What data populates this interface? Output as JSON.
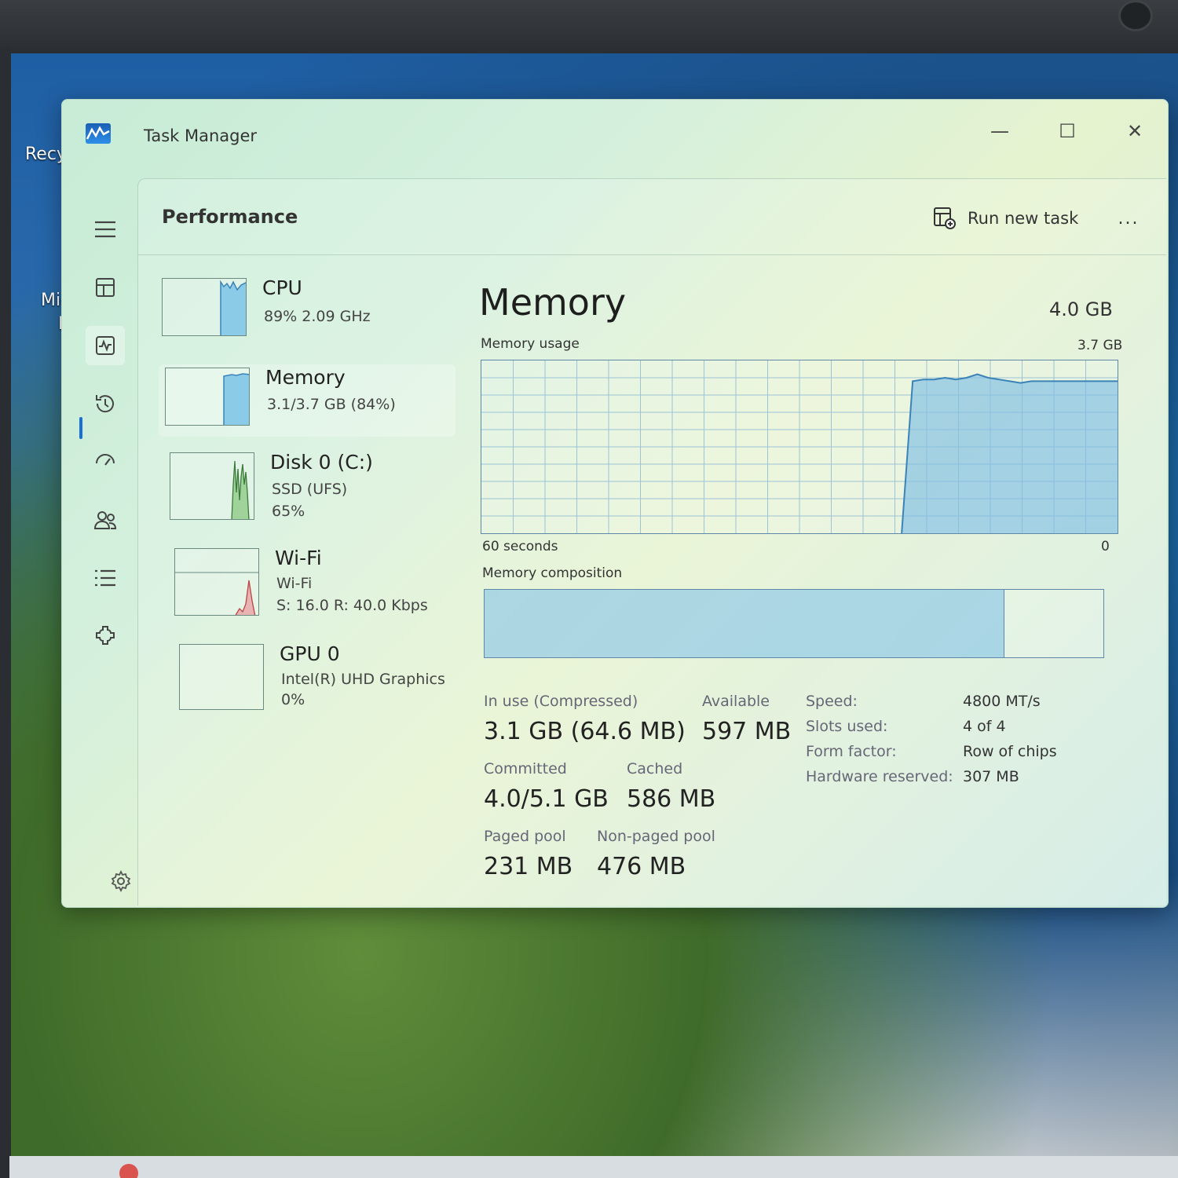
{
  "desktop": {
    "icon_labels": [
      "Recy",
      "Mic",
      "Ec"
    ]
  },
  "window": {
    "title": "Task Manager",
    "controls": {
      "minimize": "—",
      "maximize": "☐",
      "close": "✕"
    }
  },
  "header": {
    "page_title": "Performance",
    "run_new_task": "Run new task",
    "more": "..."
  },
  "nav": {
    "items": [
      {
        "name": "hamburger-menu",
        "icon": "menu-icon"
      },
      {
        "name": "processes",
        "icon": "processes-icon"
      },
      {
        "name": "performance",
        "icon": "performance-icon",
        "active": true
      },
      {
        "name": "app-history",
        "icon": "history-icon"
      },
      {
        "name": "startup-apps",
        "icon": "startup-icon"
      },
      {
        "name": "users",
        "icon": "users-icon"
      },
      {
        "name": "details",
        "icon": "details-icon"
      },
      {
        "name": "services",
        "icon": "services-icon"
      }
    ],
    "settings_icon": "gear-icon"
  },
  "perf_list": [
    {
      "name": "CPU",
      "sub1": "89%  2.09 GHz",
      "sub2": ""
    },
    {
      "name": "Memory",
      "sub1": "3.1/3.7 GB (84%)",
      "sub2": "",
      "selected": true
    },
    {
      "name": "Disk 0 (C:)",
      "sub1": "SSD (UFS)",
      "sub2": "65%"
    },
    {
      "name": "Wi-Fi",
      "sub1": "Wi-Fi",
      "sub2": "S: 16.0  R: 40.0 Kbps"
    },
    {
      "name": "GPU 0",
      "sub1": "Intel(R) UHD Graphics",
      "sub2": "0%"
    }
  ],
  "detail": {
    "title": "Memory",
    "total": "4.0 GB",
    "usage_label": "Memory usage",
    "usage_max": "3.7 GB",
    "time_left": "60 seconds",
    "time_right": "0",
    "composition_label": "Memory composition",
    "composition_in_use_fraction": 0.84,
    "stats": {
      "in_use_label": "In use (Compressed)",
      "in_use_value": "3.1 GB (64.6 MB)",
      "available_label": "Available",
      "available_value": "597 MB",
      "committed_label": "Committed",
      "committed_value": "4.0/5.1 GB",
      "cached_label": "Cached",
      "cached_value": "586 MB",
      "paged_label": "Paged pool",
      "paged_value": "231 MB",
      "nonpaged_label": "Non-paged pool",
      "nonpaged_value": "476 MB"
    },
    "specs": [
      {
        "label": "Speed:",
        "value": "4800 MT/s"
      },
      {
        "label": "Slots used:",
        "value": "4 of 4"
      },
      {
        "label": "Form factor:",
        "value": "Row of chips"
      },
      {
        "label": "Hardware reserved:",
        "value": "307 MB"
      }
    ]
  },
  "usage_graph": {
    "samples_percent": [
      0,
      0,
      0,
      0,
      0,
      0,
      0,
      0,
      0,
      0,
      0,
      0,
      0,
      0,
      0,
      0,
      0,
      0,
      0,
      0,
      0,
      0,
      0,
      0,
      0,
      0,
      0,
      0,
      0,
      0,
      0,
      0,
      0,
      0,
      0,
      0,
      0,
      0,
      0,
      0,
      88,
      89,
      89,
      90,
      89,
      90,
      92,
      90,
      89,
      88,
      87,
      88,
      88,
      88,
      88,
      88,
      88,
      88,
      88,
      88
    ]
  },
  "colors": {
    "accent": "#1a6fd6",
    "graph_fill": "#7fbfe3",
    "graph_line": "#3a83b8"
  }
}
